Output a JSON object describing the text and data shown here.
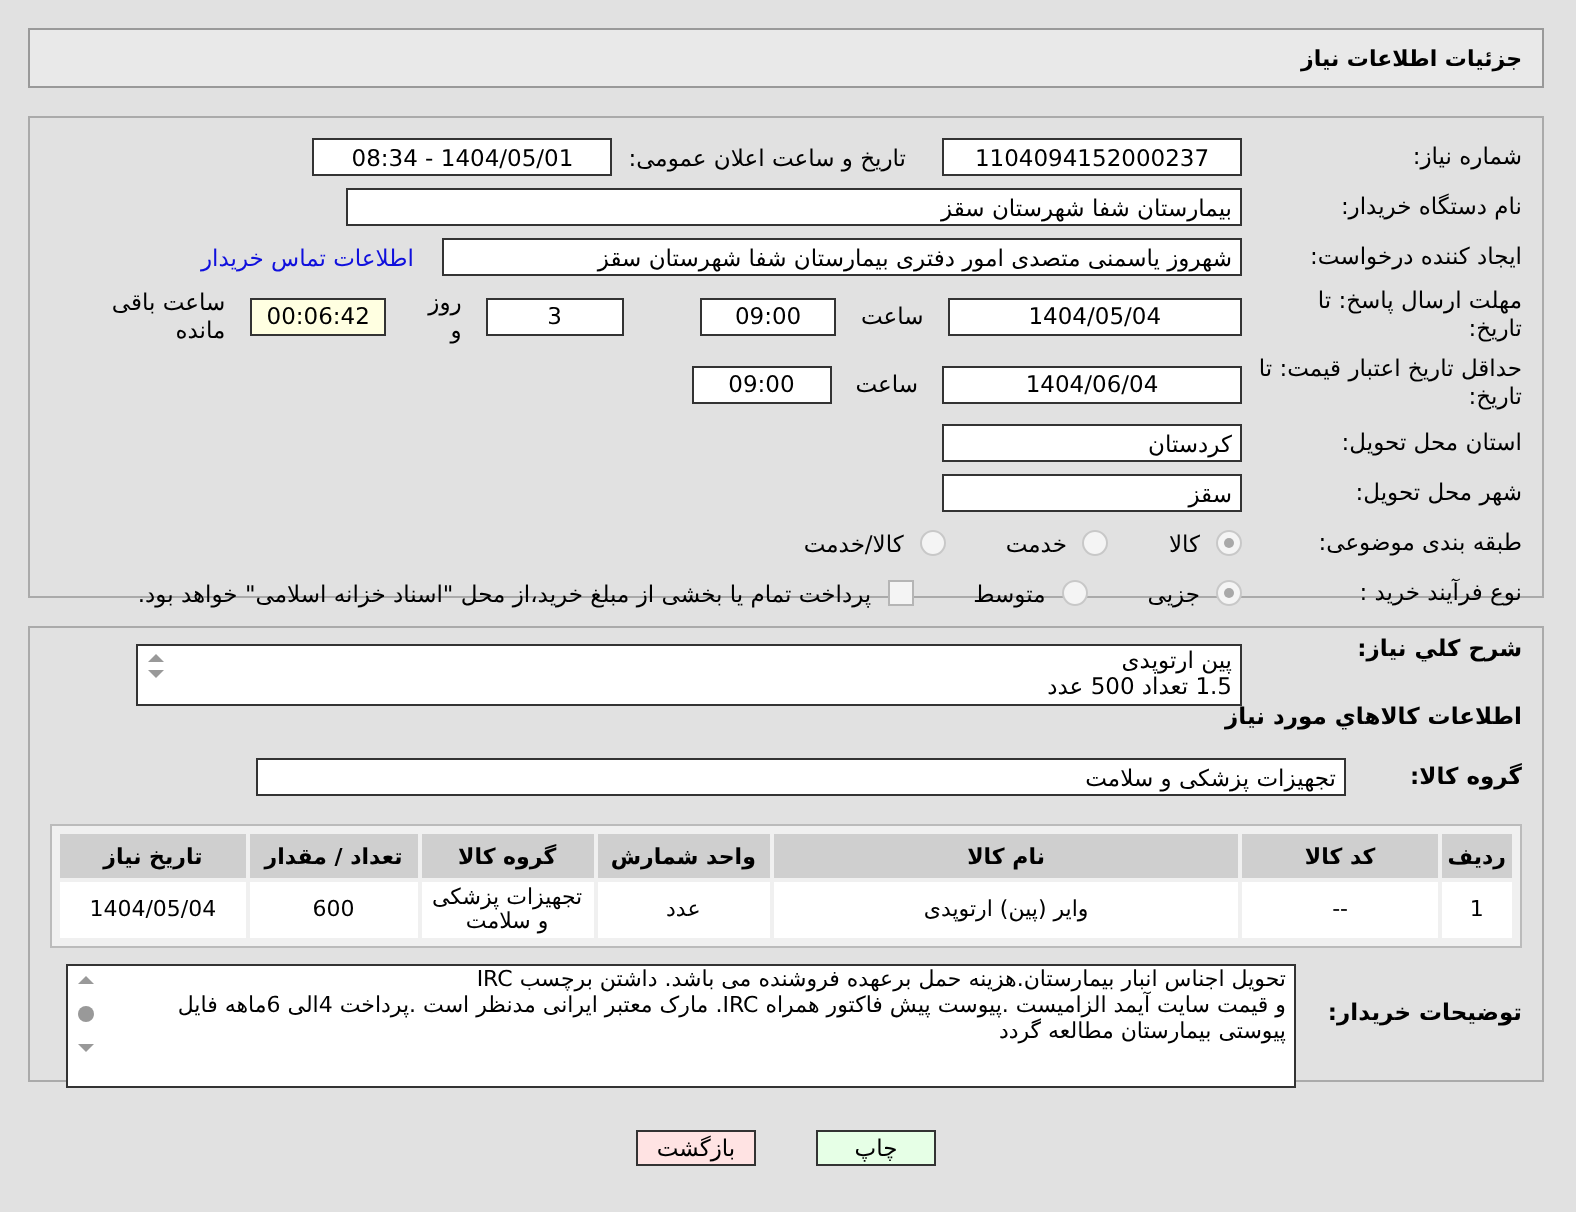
{
  "header": {
    "title": "جزئیات اطلاعات نیاز"
  },
  "need_number": {
    "label": "شماره نیاز:",
    "value": "1104094152000237"
  },
  "announce": {
    "label": "تاریخ و ساعت اعلان عمومی:",
    "value": "1404/05/01 - 08:34"
  },
  "buyer_org": {
    "label": "نام دستگاه خریدار:",
    "value": "بیمارستان شفا شهرستان سقز"
  },
  "requester": {
    "label": "ایجاد کننده درخواست:",
    "value": "شهروز یاسمنی متصدی امور دفتری بیمارستان شفا شهرستان سقز",
    "link": "اطلاعات تماس خریدار"
  },
  "reply_deadline": {
    "label": "مهلت ارسال پاسخ: تا تاریخ:",
    "date": "1404/05/04",
    "time_label": "ساعت",
    "time": "09:00",
    "days": "3",
    "days_label": "روز و",
    "remaining": "00:06:42",
    "remaining_label": "ساعت باقی مانده"
  },
  "price_validity": {
    "label": "حداقل تاریخ اعتبار قیمت: تا تاریخ:",
    "date": "1404/06/04",
    "time_label": "ساعت",
    "time": "09:00"
  },
  "province": {
    "label": "استان محل تحویل:",
    "value": "کردستان"
  },
  "city": {
    "label": "شهر محل تحویل:",
    "value": "سقز"
  },
  "category": {
    "label": "طبقه بندی موضوعی:",
    "options": [
      {
        "label": "کالا",
        "selected": true
      },
      {
        "label": "خدمت",
        "selected": false
      },
      {
        "label": "کالا/خدمت",
        "selected": false
      }
    ]
  },
  "process": {
    "label": "نوع فرآیند خرید :",
    "options": [
      {
        "label": "جزیی",
        "selected": true
      },
      {
        "label": "متوسط",
        "selected": false
      }
    ],
    "treasury": {
      "label": "پرداخت تمام یا بخشی از مبلغ خرید،از محل \"اسناد خزانه اسلامی\" خواهد بود.",
      "checked": false
    }
  },
  "description": {
    "label": "شرح کلي نياز:",
    "value": "پین ارتوپدی\n1.5 تعداد 500 عدد"
  },
  "goods_title": "اطلاعات کالاهاي مورد نياز",
  "goods_group": {
    "label": "گروه کالا:",
    "value": "تجهیزات پزشکی و سلامت"
  },
  "table": {
    "columns": [
      "ردیف",
      "کد کالا",
      "نام کالا",
      "واحد شمارش",
      "گروه کالا",
      "تعداد / مقدار",
      "تاریخ نیاز"
    ],
    "rows": [
      [
        "1",
        "--",
        "وایر (پین) ارتوپدی",
        "عدد",
        "تجهیزات پزشکی و سلامت",
        "600",
        "1404/05/04"
      ]
    ]
  },
  "buyer_notes": {
    "label": "توضیحات خریدار:",
    "value": "تحویل اجناس انبار بیمارستان.هزینه حمل برعهده فروشنده می باشد. داشتن برچسب IRC\nو قیمت سایت آیمد الزامیست .پیوست پیش فاکتور همراه IRC. مارک معتبر ایرانی مدنظر است .پرداخت 4الی 6ماهه فایل\nپیوستی بیمارستان مطالعه گردد"
  },
  "buttons": [
    {
      "kind": "print",
      "label": "چاپ"
    },
    {
      "kind": "back",
      "label": "بازگشت"
    }
  ]
}
